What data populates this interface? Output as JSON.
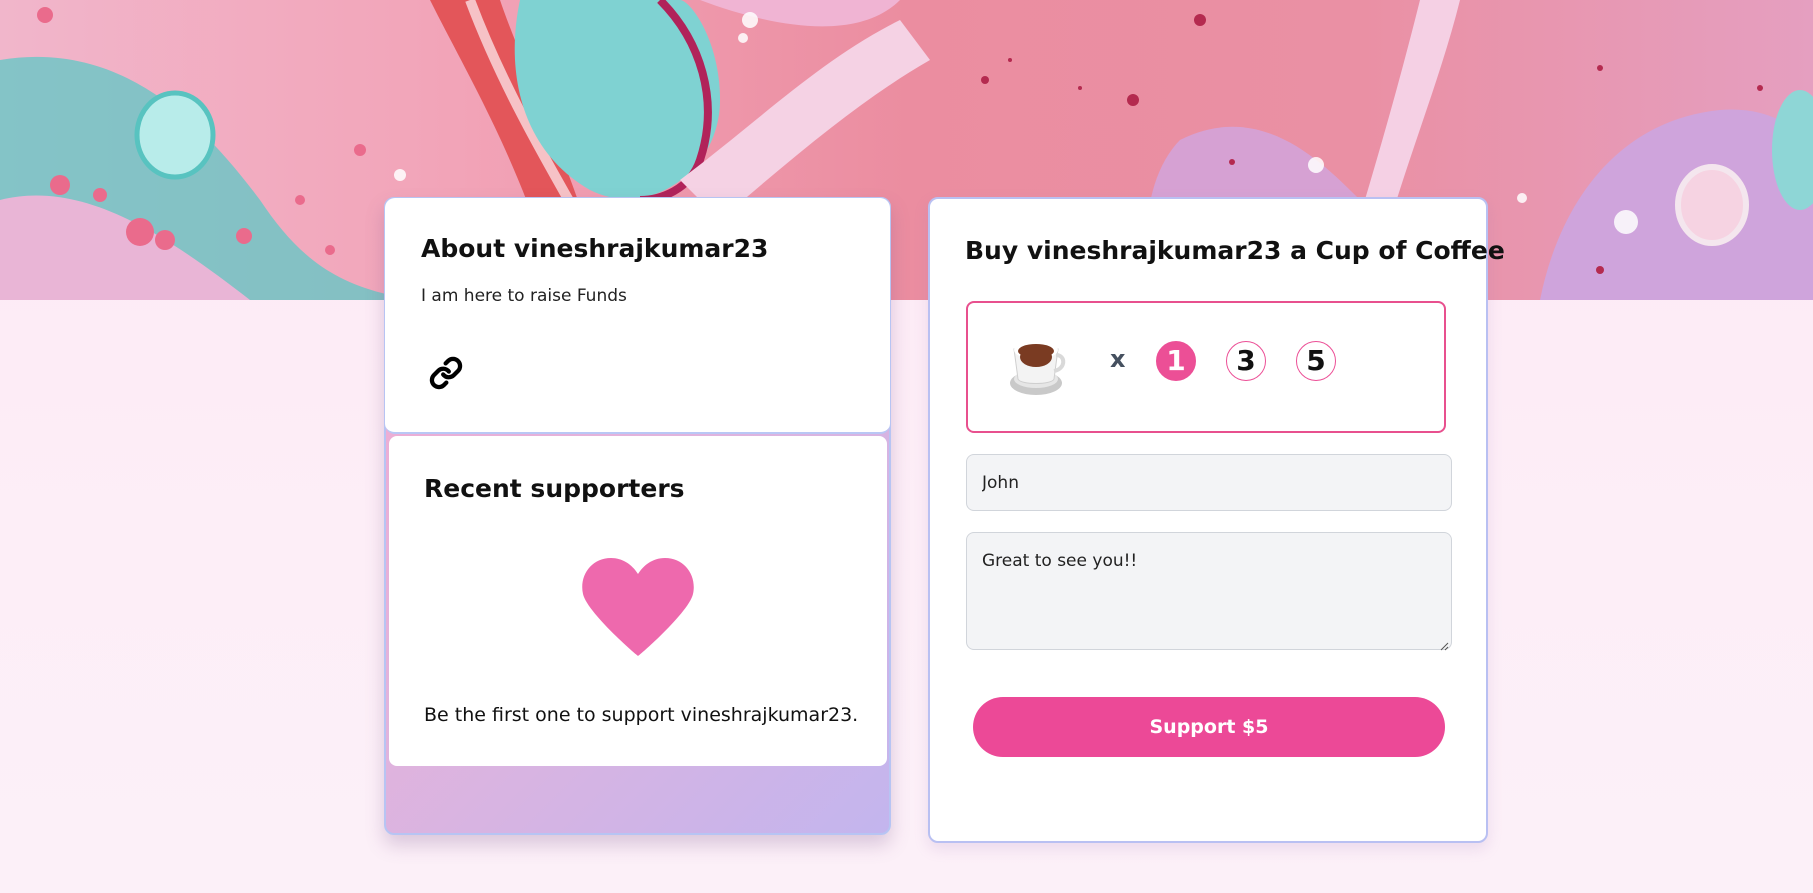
{
  "about": {
    "title": "About vineshrajkumar23",
    "description": "I am here to raise Funds",
    "link_icon": "link-icon"
  },
  "supporters": {
    "title": "Recent supporters",
    "empty_icon": "heart-icon",
    "empty_message": "Be the first one to support vineshrajkumar23."
  },
  "coffee": {
    "title": "Buy vineshrajkumar23 a Cup of Coffee",
    "cup_icon": "coffee-cup-icon",
    "multiplier": "x",
    "quantities": [
      "1",
      "3",
      "5"
    ],
    "selected_quantity": "1",
    "name_value": "John",
    "message_value": "Great to see you!!",
    "button_label": "Support $5"
  },
  "colors": {
    "accent": "#ec4997",
    "heart": "#ee69ad",
    "card_border": "#b9c0f2"
  }
}
